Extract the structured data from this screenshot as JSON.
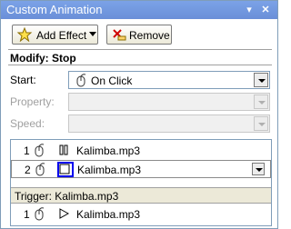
{
  "window": {
    "title": "Custom Animation"
  },
  "toolbar": {
    "add_effect_label": "Add Effect",
    "remove_label": "Remove"
  },
  "modify": {
    "heading": "Modify: Stop",
    "start_label": "Start:",
    "start_value": "On Click",
    "property_label": "Property:",
    "speed_label": "Speed:"
  },
  "effects": [
    {
      "number": "1",
      "icon": "pause-icon",
      "name": "Kalimba.mp3"
    },
    {
      "number": "2",
      "icon": "stop-icon",
      "name": "Kalimba.mp3"
    }
  ],
  "trigger": {
    "label": "Trigger: Kalimba.mp3",
    "items": [
      {
        "number": "1",
        "icon": "play-icon",
        "name": "Kalimba.mp3"
      }
    ]
  },
  "colors": {
    "title_bar": "#6a8fd8",
    "selection_box": "#0000ee"
  }
}
